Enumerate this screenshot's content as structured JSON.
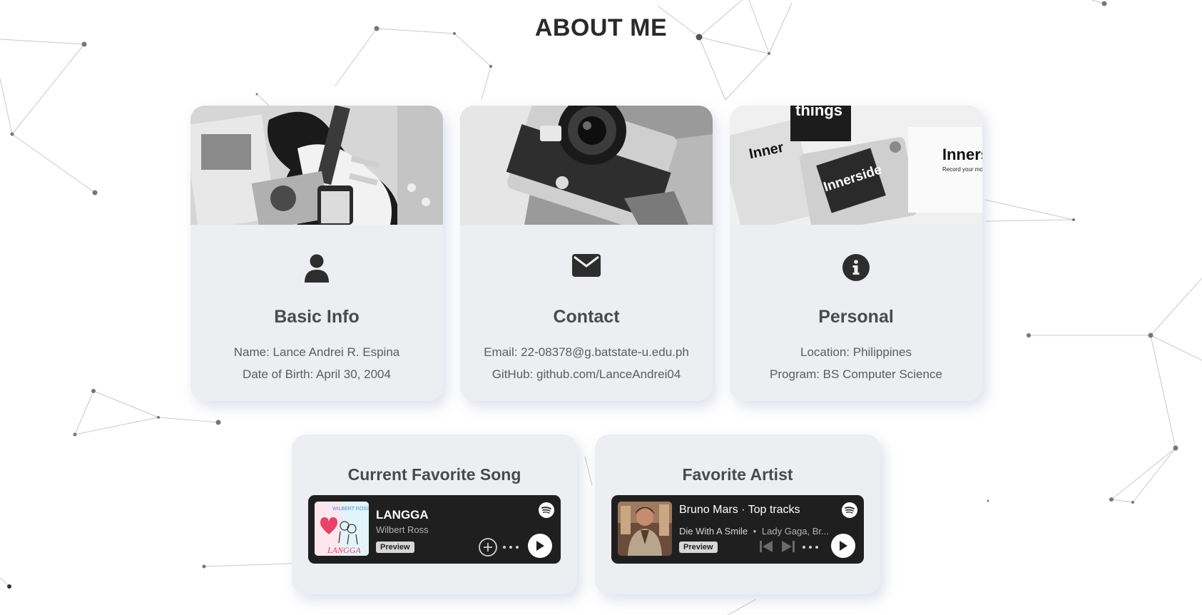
{
  "section": {
    "title": "ABOUT ME"
  },
  "cards": [
    {
      "title": "Basic Info",
      "icon": "user-icon",
      "photo": "guitar-and-magazines-photo",
      "line1": "Name: Lance Andrei R. Espina",
      "line2": "Date of Birth: April 30, 2004"
    },
    {
      "title": "Contact",
      "icon": "envelope-icon",
      "photo": "vintage-camera-photo",
      "line1": "Email: 22-08378@g.batstate-u.edu.ph",
      "line2": "GitHub: github.com/LanceAndrei04"
    },
    {
      "title": "Personal",
      "icon": "info-icon",
      "photo": "magazine-collage-photo",
      "line1": "Location: Philippines",
      "line2": "Program: BS Computer Science",
      "photo_text": {
        "t1": "things",
        "t2": "Inner",
        "t3": "Innerside",
        "t4": "Inners",
        "t5": "Record your mo"
      }
    }
  ],
  "song": {
    "heading": "Current Favorite Song",
    "track": "LANGGA",
    "artist": "Wilbert Ross",
    "badge": "Preview",
    "art_text": "LANGGA"
  },
  "artist": {
    "heading": "Favorite Artist",
    "name": "Bruno Mars · Top tracks",
    "track": "Die With A Smile",
    "track_artists": "Lady Gaga, Br...",
    "badge": "Preview"
  },
  "colors": {
    "card_bg": "#eceef1",
    "player_bg": "#1f1f1f",
    "title": "#2a2a2a",
    "text": "#5c5c5c"
  }
}
